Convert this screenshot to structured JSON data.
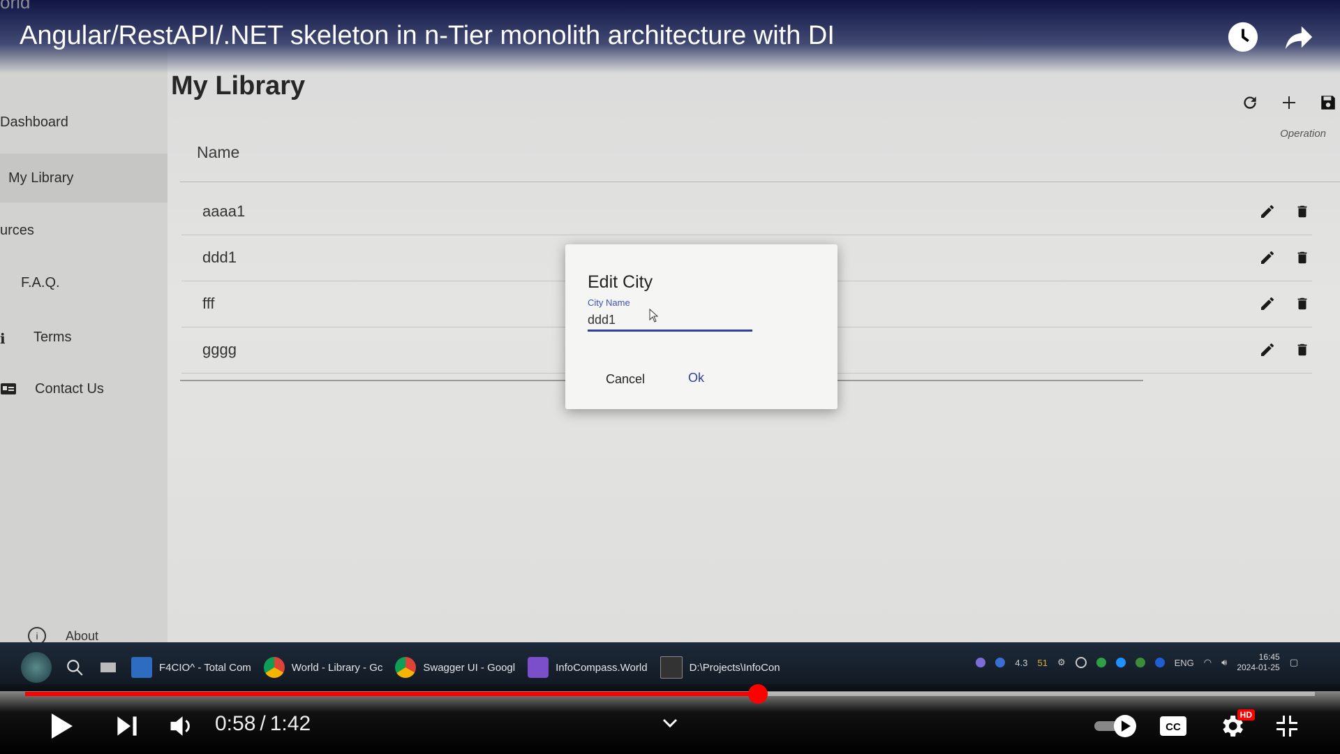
{
  "video": {
    "title": "Angular/RestAPI/.NET skeleton in n-Tier monolith architecture with DI",
    "corner_text": "orld",
    "current_time": "0:58",
    "duration": "1:42",
    "time_separator": "/",
    "progress_fraction": 0.568,
    "hd_badge": "HD",
    "top_icons": [
      "watch-later-icon",
      "share-icon"
    ],
    "controls": [
      "play-icon",
      "next-icon",
      "volume-icon",
      "chevron-down-icon",
      "autoplay-toggle",
      "captions-icon",
      "settings-icon",
      "fullscreen-exit-icon"
    ],
    "accent_color": "#ff0000"
  },
  "sidebar": {
    "items": [
      {
        "label": "Dashboard",
        "icon": "dashboard-icon"
      },
      {
        "label": "My Library",
        "icon": "library-icon",
        "active": true
      },
      {
        "label": "urces",
        "icon": "resources-icon"
      },
      {
        "label": "F.A.Q.",
        "icon": "faq-icon"
      },
      {
        "label": "Terms",
        "icon": "terms-icon"
      },
      {
        "label": "Contact Us",
        "icon": "contact-icon"
      }
    ],
    "about_label": "About"
  },
  "main": {
    "title": "My Library",
    "column_name": "Name",
    "operation_label": "Operation",
    "toolbar_icons": [
      "refresh-icon",
      "add-icon",
      "save-icon"
    ],
    "rows": [
      "aaaa1",
      "ddd1",
      "fff",
      "gggg"
    ],
    "row_icons": [
      "edit-icon",
      "delete-icon"
    ]
  },
  "dialog": {
    "title": "Edit City",
    "field_label": "City Name",
    "field_value": "ddd1",
    "cancel_label": "Cancel",
    "ok_label": "Ok",
    "accent_color": "#303f9f"
  },
  "taskbar": {
    "apps": [
      {
        "label": "F4CIO^ - Total Com",
        "icon": "total-commander-icon"
      },
      {
        "label": "World - Library - Gc",
        "icon": "chrome-icon"
      },
      {
        "label": "Swagger UI - Googl",
        "icon": "chrome-icon"
      },
      {
        "label": "InfoCompass.World",
        "icon": "visual-studio-icon"
      },
      {
        "label": "D:\\Projects\\InfoCon",
        "icon": "terminal-icon"
      }
    ],
    "tray_values": [
      "4.3",
      "51",
      "ENG"
    ],
    "clock_time": "16:45",
    "clock_date": "2024-01-25"
  }
}
